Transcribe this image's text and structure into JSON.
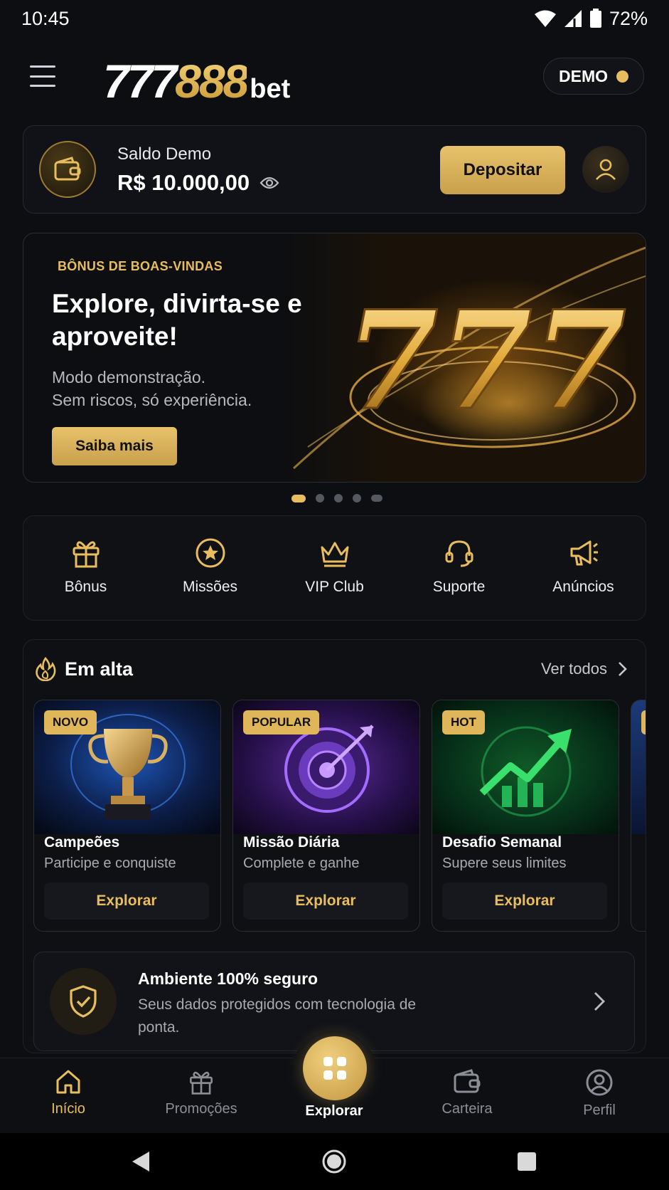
{
  "status": {
    "time": "10:45",
    "battery": "72%"
  },
  "header": {
    "logo_part1": "777",
    "logo_part2": "888",
    "logo_part3": "bet",
    "demo_label": "DEMO"
  },
  "balance": {
    "label": "Saldo Demo",
    "amount": "R$ 10.000,00",
    "deposit_label": "Depositar"
  },
  "banner": {
    "kicker": "BÔNUS DE BOAS-VINDAS",
    "title": "Explore, divirta-se e aproveite!",
    "subtitle_line1": "Modo demonstração.",
    "subtitle_line2": "Sem riscos, só experiência.",
    "button": "Saiba mais",
    "art_text": "777",
    "slides": 5,
    "active_slide": 1
  },
  "quick_actions": [
    {
      "label": "Bônus",
      "icon": "gift-icon"
    },
    {
      "label": "Missões",
      "icon": "star-circle-icon"
    },
    {
      "label": "VIP Club",
      "icon": "crown-icon"
    },
    {
      "label": "Suporte",
      "icon": "headset-icon"
    },
    {
      "label": "Anúncios",
      "icon": "megaphone-icon"
    }
  ],
  "trending": {
    "title": "Em alta",
    "see_all": "Ver todos",
    "cards": [
      {
        "badge": "NOVO",
        "title": "Campeões",
        "subtitle": "Participe e conquiste",
        "button": "Explorar",
        "image": "trophy"
      },
      {
        "badge": "POPULAR",
        "title": "Missão Diária",
        "subtitle": "Complete e ganhe",
        "button": "Explorar",
        "image": "target"
      },
      {
        "badge": "HOT",
        "title": "Desafio Semanal",
        "subtitle": "Supere seus limites",
        "button": "Explorar",
        "image": "growth-chart"
      }
    ]
  },
  "secure": {
    "title": "Ambiente 100% seguro",
    "subtitle": "Seus dados protegidos com tecnologia de ponta."
  },
  "bottom_nav": {
    "home": "Início",
    "promos": "Promoções",
    "explore": "Explorar",
    "wallet": "Carteira",
    "profile": "Perfil"
  },
  "colors": {
    "accent": "#e7bd5e",
    "background": "#0c0e12"
  }
}
